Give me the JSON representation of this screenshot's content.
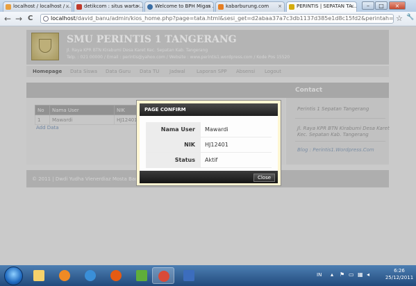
{
  "browser": {
    "tabs": [
      {
        "title": "localhost / localhost / ...",
        "color": "#e8a040",
        "active": false
      },
      {
        "title": "detikcom : situs warta ...",
        "color": "#c0392b",
        "active": false
      },
      {
        "title": "Welcome to BPH Migas ...",
        "color": "#3a6ea5",
        "active": false
      },
      {
        "title": "kabarburung.com",
        "color": "#e67e22",
        "active": false
      },
      {
        "title": "PERINTIS | SEPATAN TA...",
        "color": "#d4ac0d",
        "active": true
      }
    ],
    "tab_close": "×",
    "window_buttons": {
      "minimize": "–",
      "maximize": "□",
      "close": "×"
    },
    "nav": {
      "back": "←",
      "forward": "→",
      "reload": "C"
    },
    "url_host": "localhost",
    "url_path": "/david_banu/admin/kios_home.php?page=tata.html&sesi_get=d2abaa37a7c3db1137d385e1d8c15fd2&perintah=detail",
    "star": "☆",
    "wrench": "🔧"
  },
  "site": {
    "school_name": "SMU PERINTIS 1 TANGERANG",
    "address_line1": "Jl. Raya KPR BTN Kirabumi Desa Karet Kec. Sepatan Kab. Tangerang",
    "address_line2": "Telp. : 021 00000 / Email : perintis@yahoo.com / Website : www.perintis1.wordpress.com / Kode Pos 15520",
    "menu": [
      "Homepage",
      "Data Siswa",
      "Data Guru",
      "Data TU",
      "Jadwal",
      "Laporan SPP",
      "Absensi",
      "Logout"
    ],
    "contact_title": "Contact",
    "sidebar": {
      "line1": "Perintis 1 Sepatan Tangerang",
      "line2": "Jl. Raya KPR BTN Kirabumi Desa Karet",
      "line3": "Kec. Sepatan Kab. Tangerang",
      "line4": "Blog : Perintis1.Wordpress.Com"
    },
    "table": {
      "headers": [
        "No",
        "Nama User",
        "NIK"
      ],
      "rows": [
        [
          "1",
          "Mawardi",
          "HJ12401"
        ]
      ]
    },
    "add_link": "Add Data",
    "footer": "© 2011 | Dwdi Yudha Vienerdiaz Mosta Baung"
  },
  "modal": {
    "title": "PAGE CONFIRM",
    "fields": [
      {
        "label": "Nama User",
        "value": "Mawardi"
      },
      {
        "label": "NIK",
        "value": "HJ12401"
      },
      {
        "label": "Status",
        "value": "Aktif"
      }
    ],
    "close_label": "Close"
  },
  "taskbar": {
    "apps": [
      {
        "name": "explorer-icon",
        "color": "#f5d26b"
      },
      {
        "name": "media-player-icon",
        "color": "#f08a24"
      },
      {
        "name": "ie-icon",
        "color": "#3a8fd8"
      },
      {
        "name": "firefox-icon",
        "color": "#e55b13"
      },
      {
        "name": "winamp-icon",
        "color": "#5fae3a"
      },
      {
        "name": "chrome-icon",
        "color": "#d94a38"
      },
      {
        "name": "word-icon",
        "color": "#3c6dbd"
      }
    ],
    "lang": "IN",
    "time": "6:26",
    "date": "25/12/2011"
  }
}
